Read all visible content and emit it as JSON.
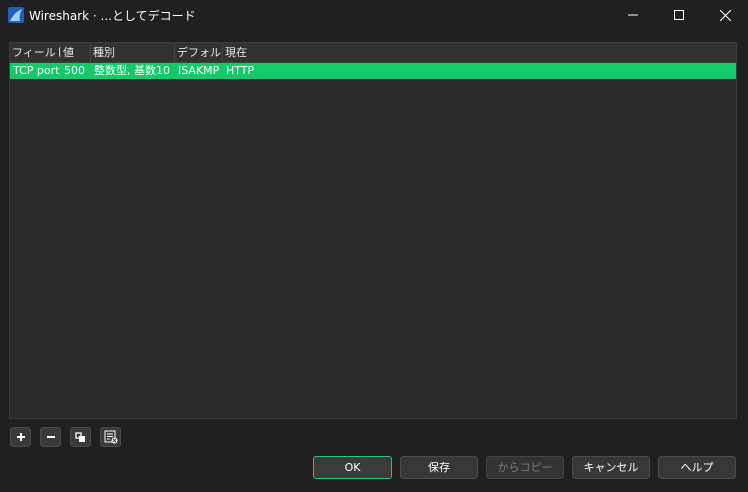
{
  "window": {
    "title": "Wireshark · ...としてデコード",
    "controls": {
      "minimize_icon": "minimize-icon",
      "maximize_icon": "maximize-icon",
      "close_icon": "close-icon"
    }
  },
  "table": {
    "columns": [
      "フィールド",
      "値",
      "種別",
      "デフォルト",
      "現在"
    ],
    "rows": [
      {
        "field": "TCP port",
        "value": "500",
        "type": "整数型, 基数10",
        "default": "ISAKMP",
        "current": "HTTP",
        "selected": true
      }
    ]
  },
  "toolbar": {
    "add_icon": "plus-icon",
    "remove_icon": "minus-icon",
    "copy_icon": "copy-icon",
    "clear_icon": "clear-list-icon"
  },
  "buttons": {
    "ok": "OK",
    "save": "保存",
    "copy_from": "からコピー",
    "cancel": "キャンセル",
    "help": "ヘルプ"
  },
  "colors": {
    "selection": "#13c96a",
    "ok_border": "#2ec27e",
    "background": "#202020",
    "table_bg": "#2b2b2b"
  }
}
